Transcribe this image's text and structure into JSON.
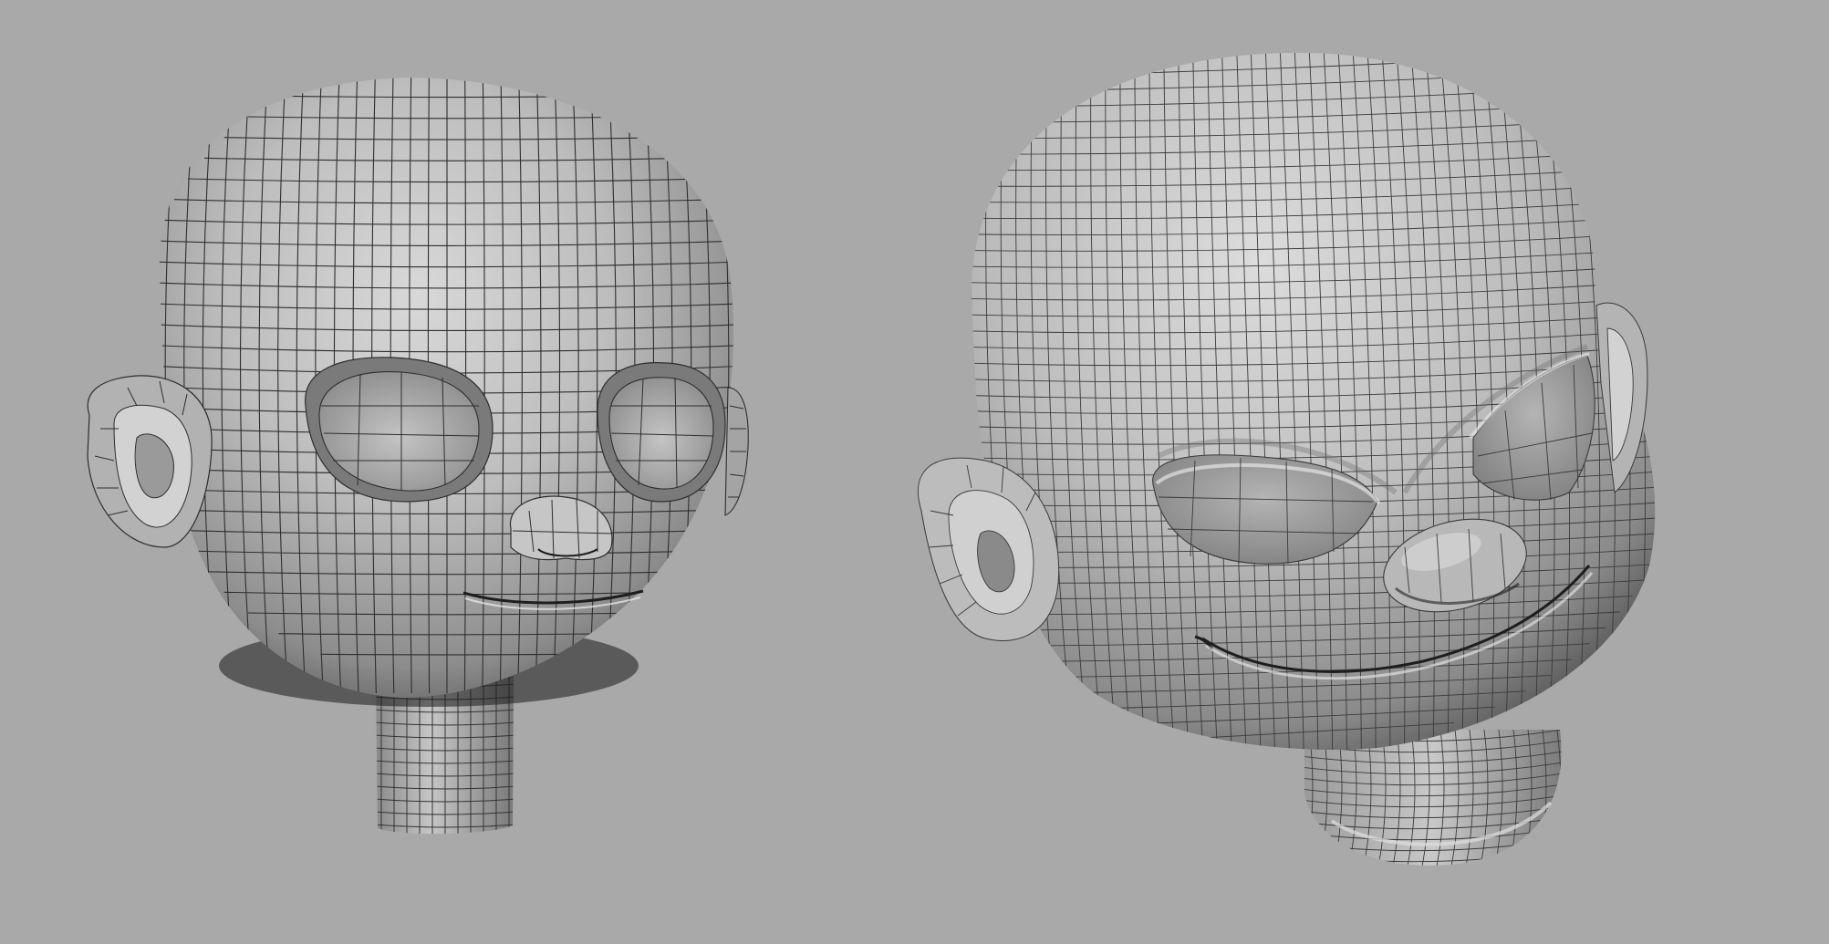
{
  "viewport": {
    "background": "#a9a9a9"
  },
  "models": [
    {
      "id": "left",
      "description_name": "low-poly-cartoon-head",
      "base_color": "#b9b9b9",
      "wire_color": "#2a2a2a"
    },
    {
      "id": "right",
      "description_name": "subdivided-cartoon-head",
      "base_color": "#c2c2c2",
      "wire_color": "#3a3a3a"
    }
  ]
}
